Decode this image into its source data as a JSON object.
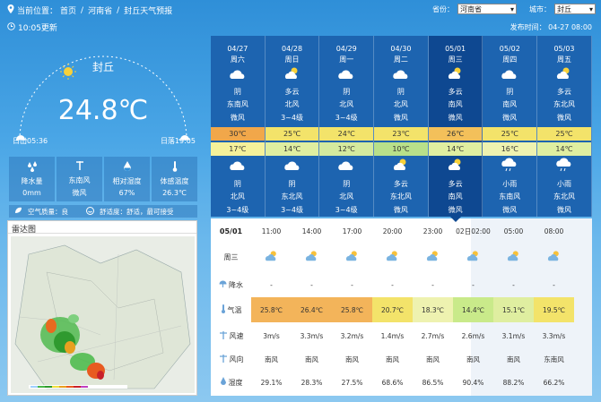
{
  "breadcrumb": {
    "prefix": "当前位置：",
    "items": [
      "首页",
      "河南省",
      "封丘天气预报"
    ]
  },
  "selectors": {
    "province_label": "省份：",
    "province_value": "河南省",
    "city_label": "城市：",
    "city_value": "封丘"
  },
  "updated": "10:05更新",
  "published": "发布时间： 04-27 08:00",
  "current": {
    "city": "封丘",
    "temp": "24.8℃",
    "sunrise": "日出05:36",
    "sunset": "日落19:05"
  },
  "stats": [
    {
      "icon": "rain-drops-icon",
      "label": "降水量",
      "value": "0mm"
    },
    {
      "icon": "wind-direction-icon",
      "label": "东南风",
      "value": "微风"
    },
    {
      "icon": "humidity-icon",
      "label": "相对湿度",
      "value": "67%"
    },
    {
      "icon": "thermometer-icon",
      "label": "体感温度",
      "value": "26.3℃"
    }
  ],
  "air": {
    "aq": "空气质量：良",
    "comfort": "舒适度：舒适，最可接受"
  },
  "radar": {
    "title": "雷达图"
  },
  "forecast": [
    {
      "date": "04/27",
      "week": "周六",
      "d_weather": "阴",
      "d_wind": "东南风",
      "d_level": "微风",
      "high": "30℃",
      "low": "17℃",
      "n_weather": "阴",
      "n_wind": "北风",
      "n_level": "3~4级",
      "hi_color": "#f1a74a",
      "lo_color": "#f5f19a"
    },
    {
      "date": "04/28",
      "week": "周日",
      "d_weather": "多云",
      "d_wind": "北风",
      "d_level": "3~4级",
      "high": "25℃",
      "low": "14℃",
      "n_weather": "阴",
      "n_wind": "东北风",
      "n_level": "3~4级",
      "hi_color": "#f3e36a",
      "lo_color": "#dfeea0"
    },
    {
      "date": "04/29",
      "week": "周一",
      "d_weather": "阴",
      "d_wind": "北风",
      "d_level": "3~4级",
      "high": "24℃",
      "low": "12℃",
      "n_weather": "阴",
      "n_wind": "北风",
      "n_level": "3~4级",
      "hi_color": "#f3e36a",
      "lo_color": "#d4ea9e"
    },
    {
      "date": "04/30",
      "week": "周二",
      "d_weather": "阴",
      "d_wind": "北风",
      "d_level": "微风",
      "high": "23℃",
      "low": "10℃",
      "n_weather": "多云",
      "n_wind": "东北风",
      "n_level": "微风",
      "hi_color": "#f3e36a",
      "lo_color": "#b8e08a"
    },
    {
      "date": "05/01",
      "week": "周三",
      "d_weather": "多云",
      "d_wind": "南风",
      "d_level": "微风",
      "high": "26℃",
      "low": "14℃",
      "n_weather": "多云",
      "n_wind": "南风",
      "n_level": "微风",
      "hi_color": "#f3c05a",
      "lo_color": "#dfeea0"
    },
    {
      "date": "05/02",
      "week": "周四",
      "d_weather": "阴",
      "d_wind": "南风",
      "d_level": "微风",
      "high": "25℃",
      "low": "16℃",
      "n_weather": "小雨",
      "n_wind": "东南风",
      "n_level": "微风",
      "hi_color": "#f3e36a",
      "lo_color": "#eef2b0"
    },
    {
      "date": "05/03",
      "week": "周五",
      "d_weather": "多云",
      "d_wind": "东北风",
      "d_level": "微风",
      "high": "25℃",
      "low": "14℃",
      "n_weather": "小雨",
      "n_wind": "东北风",
      "n_level": "微风",
      "hi_color": "#f3e36a",
      "lo_color": "#dfeea0"
    }
  ],
  "hourly": {
    "day": "05/01",
    "week": "周三",
    "labels": {
      "rain": "降水",
      "temp": "气温",
      "wind": "风速",
      "dir": "风向",
      "hum": "湿度"
    },
    "times": [
      "11:00",
      "14:00",
      "17:00",
      "20:00",
      "23:00",
      "02日02:00",
      "05:00",
      "08:00"
    ],
    "rain": [
      "-",
      "-",
      "-",
      "-",
      "-",
      "-",
      "-",
      "-"
    ],
    "temp": [
      "25.8℃",
      "26.4℃",
      "25.8℃",
      "20.7℃",
      "18.3℃",
      "14.4℃",
      "15.1℃",
      "19.5℃"
    ],
    "temp_colors": [
      "#f3b45a",
      "#f3b45a",
      "#f3b45a",
      "#f3e36a",
      "#eef2b0",
      "#c9ea8a",
      "#dfeea0",
      "#f3e36a"
    ],
    "wind": [
      "3m/s",
      "3.3m/s",
      "3.2m/s",
      "1.4m/s",
      "2.7m/s",
      "2.6m/s",
      "3.1m/s",
      "3.3m/s"
    ],
    "dir": [
      "南风",
      "南风",
      "南风",
      "南风",
      "南风",
      "南风",
      "南风",
      "东南风"
    ],
    "hum": [
      "29.1%",
      "28.3%",
      "27.5%",
      "68.6%",
      "86.5%",
      "90.4%",
      "88.2%",
      "66.2%"
    ]
  }
}
